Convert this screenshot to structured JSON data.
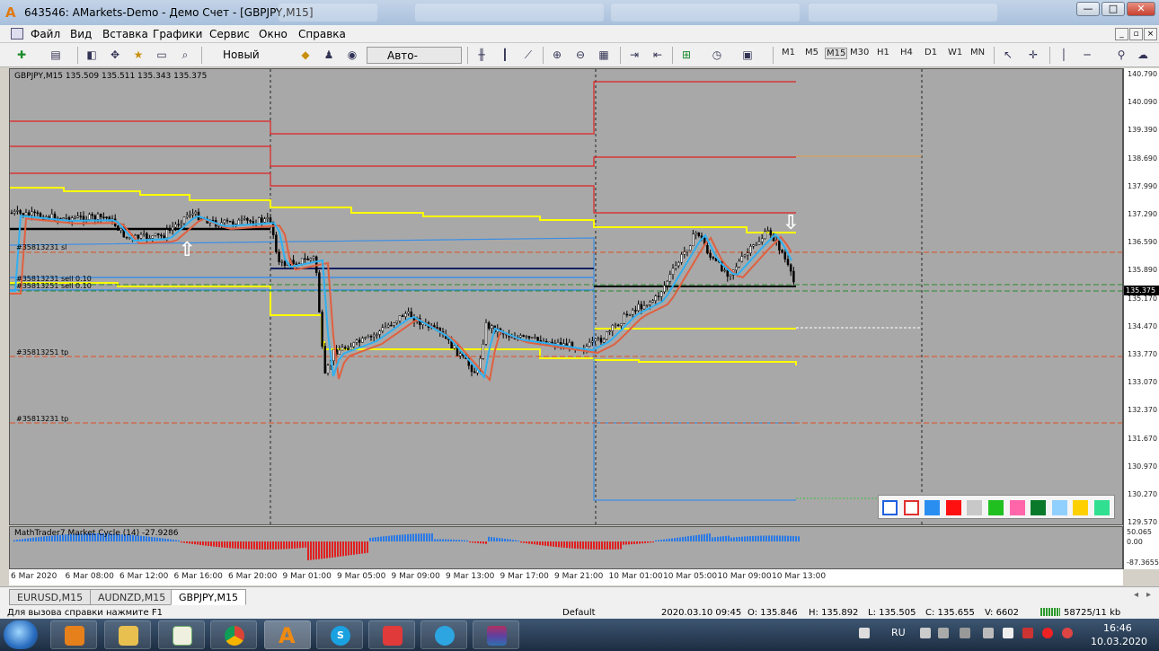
{
  "window": {
    "title": "643546: AMarkets-Demo - Демо Счет - [GBPJPY,M15]",
    "controls": [
      "—",
      "□",
      "✕"
    ]
  },
  "menu": [
    "Файл",
    "Вид",
    "Вставка",
    "Графики",
    "Сервис",
    "Окно",
    "Справка"
  ],
  "toolbar": {
    "new_order": "Новый ордер",
    "auto_trading": "Авто-торговля",
    "timeframes": [
      "M1",
      "M5",
      "M15",
      "M30",
      "H1",
      "H4",
      "D1",
      "W1",
      "MN"
    ],
    "active_timeframe": "M15"
  },
  "chart": {
    "info": "GBPJPY,M15  135.509 135.511 135.343 135.375",
    "current_price": "135.375",
    "price_labels": [
      "140.790",
      "140.090",
      "139.390",
      "138.690",
      "137.990",
      "137.290",
      "136.590",
      "135.890",
      "135.170",
      "134.470",
      "133.770",
      "133.070",
      "132.370",
      "131.670",
      "130.970",
      "130.270",
      "129.570"
    ],
    "time_labels": [
      "6 Mar 2020",
      "6 Mar 08:00",
      "6 Mar 12:00",
      "6 Mar 16:00",
      "6 Mar 20:00",
      "9 Mar 01:00",
      "9 Mar 05:00",
      "9 Mar 09:00",
      "9 Mar 13:00",
      "9 Mar 17:00",
      "9 Mar 21:00",
      "10 Mar 01:00",
      "10 Mar 05:00",
      "10 Mar 09:00",
      "10 Mar 13:00"
    ],
    "order_labels": {
      "sl": "#35813231 sl",
      "sell1": "#35813231 sell 0.10",
      "sell2": "#35813251 sell 0.10",
      "tp1": "#35813251 tp",
      "tp2": "#35813231 tp"
    },
    "colors": {
      "background": "#a8a8a8",
      "red_level": "#e02020",
      "yellow_level": "#ffff00",
      "blue_level": "#3a8ee6",
      "bull": "#000000"
    }
  },
  "indicator": {
    "label": "MathTrader7 Market Cycle (14) -27.9286",
    "scale": [
      "50.065",
      "0.00",
      "-87.3655"
    ]
  },
  "symbol_tabs": [
    "EURUSD,M15",
    "AUDNZD,M15",
    "GBPJPY,M15"
  ],
  "active_symbol_tab": "GBPJPY,M15",
  "status": {
    "help": "Для вызова справки нажмите F1",
    "profile": "Default",
    "datetime": "2020.03.10 09:45",
    "open": "O: 135.846",
    "high": "H: 135.892",
    "low": "L: 135.505",
    "close": "C: 135.655",
    "volume": "V: 6602",
    "traffic": "58725/11 kb"
  },
  "taskbar": {
    "lang": "RU",
    "time": "16:46",
    "date": "10.03.2020",
    "apps": [
      "media-player",
      "file-explorer",
      "trading-terminal-old",
      "chrome",
      "amarkets-mt4",
      "skype",
      "analyzer",
      "telegram",
      "winrar"
    ]
  },
  "palette_colors": [
    "#2060e0",
    "#e03030",
    "#2a8ef0",
    "#ff1010",
    "#c8c8c8",
    "#20c020",
    "#ff66aa",
    "#0a7a2a",
    "#90d0ff",
    "#ffd000",
    "#30e090"
  ]
}
